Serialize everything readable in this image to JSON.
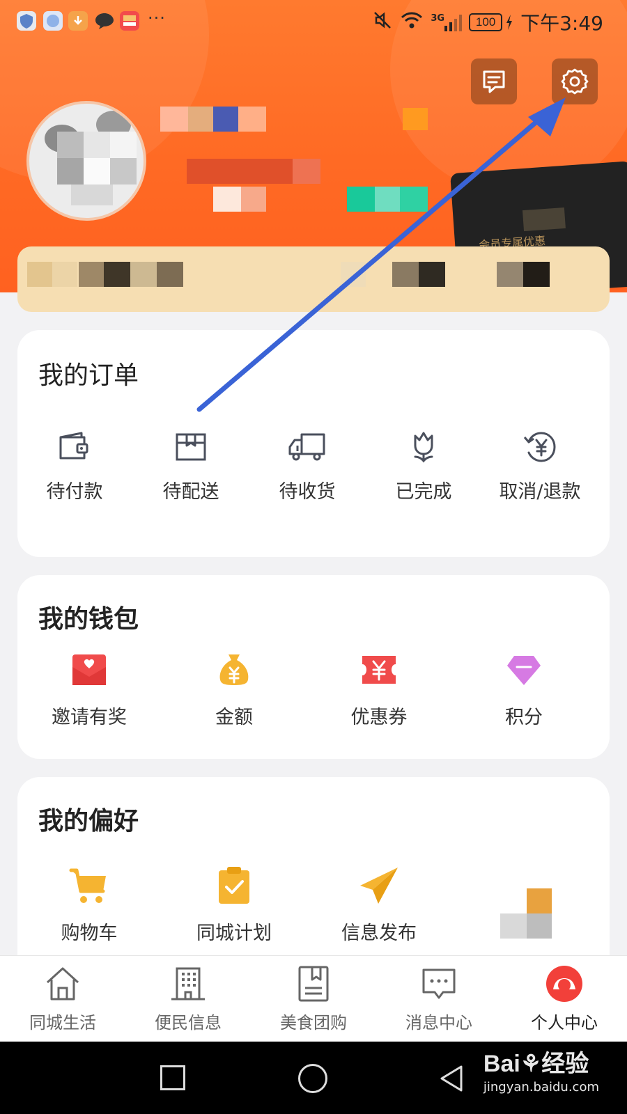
{
  "status_bar": {
    "network_label": "3G",
    "battery": "100",
    "time": "下午3:49",
    "more": "···"
  },
  "header": {
    "member_card_tag": "会员专属优惠"
  },
  "orders": {
    "title": "我的订单",
    "items": [
      {
        "label": "待付款",
        "icon": "wallet-icon"
      },
      {
        "label": "待配送",
        "icon": "package-icon"
      },
      {
        "label": "待收货",
        "icon": "truck-icon"
      },
      {
        "label": "已完成",
        "icon": "tulip-icon"
      },
      {
        "label": "取消/退款",
        "icon": "refund-icon"
      }
    ]
  },
  "wallet": {
    "title": "我的钱包",
    "items": [
      {
        "label": "邀请有奖",
        "icon": "invite-envelope-icon"
      },
      {
        "label": "金额",
        "icon": "money-bag-icon"
      },
      {
        "label": "优惠券",
        "icon": "coupon-icon"
      },
      {
        "label": "积分",
        "icon": "diamond-icon"
      }
    ]
  },
  "preferences": {
    "title": "我的偏好",
    "items": [
      {
        "label": "购物车",
        "icon": "cart-icon"
      },
      {
        "label": "同城计划",
        "icon": "clipboard-check-icon"
      },
      {
        "label": "信息发布",
        "icon": "paper-plane-icon"
      }
    ]
  },
  "tabbar": {
    "items": [
      {
        "label": "同城生活",
        "icon": "home-icon"
      },
      {
        "label": "便民信息",
        "icon": "building-icon"
      },
      {
        "label": "美食团购",
        "icon": "bookmark-book-icon"
      },
      {
        "label": "消息中心",
        "icon": "chat-bubble-icon"
      },
      {
        "label": "个人中心",
        "icon": "profile-icon",
        "active": true
      }
    ]
  },
  "watermark": {
    "brand": "Bai⚘经验",
    "url": "jingyan.baidu.com"
  },
  "colors": {
    "header_orange": "#ff6a24",
    "vip_strip": "#f6deb2",
    "annotation_arrow": "#3a63d6",
    "icon_red": "#f04b4b",
    "icon_gold": "#f5b431",
    "icon_purple": "#d67ae3"
  }
}
